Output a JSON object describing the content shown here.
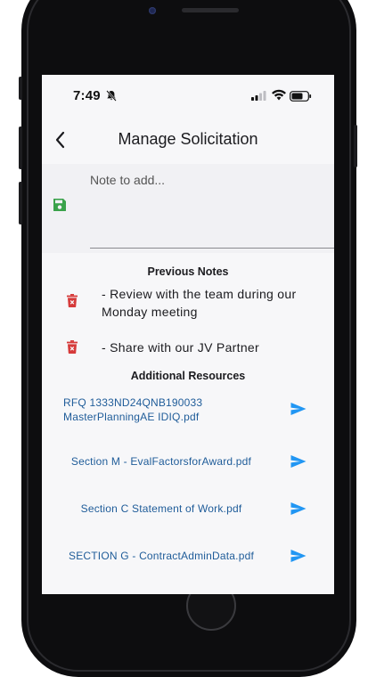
{
  "status_bar": {
    "time": "7:49"
  },
  "header": {
    "title": "Manage Solicitation"
  },
  "note_input": {
    "placeholder": "Note to add..."
  },
  "previous_notes": {
    "heading": "Previous Notes",
    "items": [
      {
        "text": "- Review with the team during our Monday meeting"
      },
      {
        "text": "- Share with our JV Partner"
      }
    ]
  },
  "resources": {
    "heading": "Additional Resources",
    "items": [
      {
        "label": "RFQ 1333ND24QNB190033 MasterPlanningAE IDIQ.pdf"
      },
      {
        "label": "Section M - EvalFactorsforAward.pdf"
      },
      {
        "label": "Section C Statement of Work.pdf"
      },
      {
        "label": "SECTION G - ContractAdminData.pdf"
      }
    ]
  },
  "icons": {
    "back": "chevron-left-icon",
    "save": "save-icon",
    "delete": "trash-icon",
    "send": "send-icon",
    "silent": "bell-slash-icon"
  },
  "colors": {
    "save": "#3aa24a",
    "delete": "#d63a3a",
    "send": "#2196f3",
    "link": "#1f5c99"
  }
}
